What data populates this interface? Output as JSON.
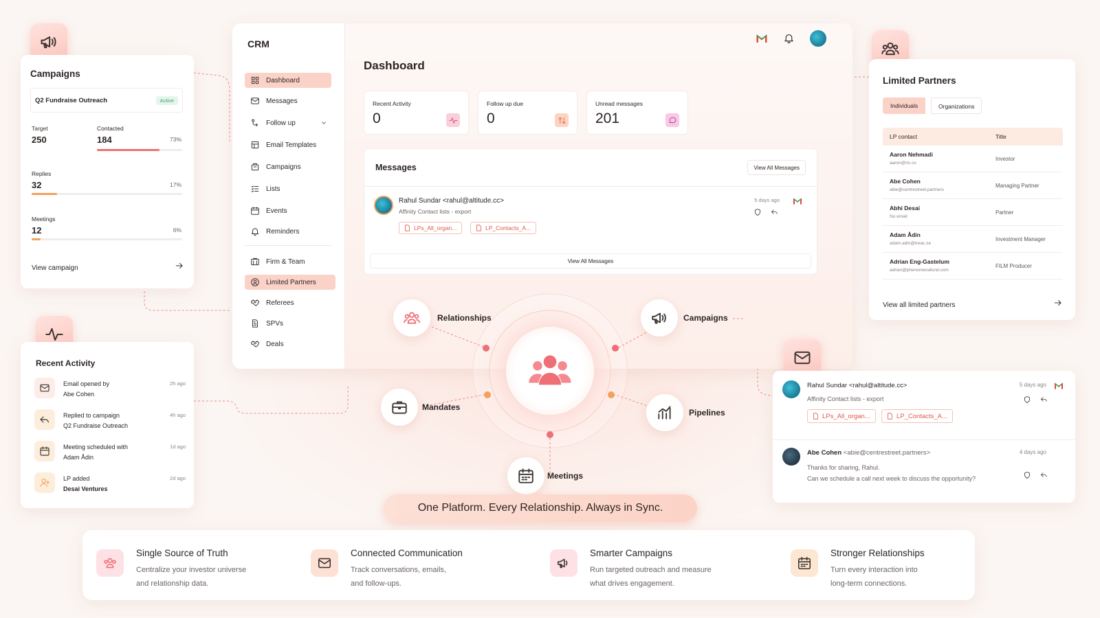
{
  "campaigns": {
    "title": "Campaigns",
    "campaign_name": "Q2 Fundraise Outreach",
    "status": "Active",
    "target_label": "Target",
    "target_value": "250",
    "contacted_label": "Contacted",
    "contacted_value": "184",
    "contacted_pct": "73%",
    "contacted_fraction": 0.73,
    "replies_label": "Replies",
    "replies_value": "32",
    "replies_pct": "17%",
    "replies_fraction": 0.17,
    "meetings_label": "Meetings",
    "meetings_value": "12",
    "meetings_pct": "6%",
    "meetings_fraction": 0.06,
    "view_link": "View campaign"
  },
  "recent_activity": {
    "title": "Recent Activity",
    "items": [
      {
        "line1": "Email opened by",
        "line2": "Abe Cohen",
        "ago": "2h ago",
        "icon": "mail-icon"
      },
      {
        "line1": "Replied to campaign",
        "line2": "Q2 Fundraise Outreach",
        "ago": "4h ago",
        "icon": "reply-icon"
      },
      {
        "line1": "Meeting scheduled with",
        "line2": "Adam Ådin",
        "ago": "1d ago",
        "icon": "calendar-icon"
      },
      {
        "line1": "LP added",
        "line2": "Desai Ventures",
        "ago": "2d ago",
        "icon": "user-add-icon"
      }
    ]
  },
  "crm": {
    "app_title": "CRM",
    "nav": [
      {
        "label": "Dashboard",
        "icon": "grid-icon",
        "active": true
      },
      {
        "label": "Messages",
        "icon": "mail-icon"
      },
      {
        "label": "Follow up",
        "icon": "follow-up-icon",
        "expandable": true
      },
      {
        "label": "Email Templates",
        "icon": "template-icon"
      },
      {
        "label": "Campaigns",
        "icon": "campaign-icon"
      },
      {
        "label": "Lists",
        "icon": "list-icon"
      },
      {
        "label": "Events",
        "icon": "calendar-icon"
      },
      {
        "label": "Reminders",
        "icon": "bell-icon"
      },
      {
        "label": "Firm & Team",
        "icon": "building-icon"
      },
      {
        "label": "Limited Partners",
        "icon": "user-circle-icon",
        "active": true
      },
      {
        "label": "Referees",
        "icon": "handshake-icon"
      },
      {
        "label": "SPVs",
        "icon": "document-icon"
      },
      {
        "label": "Deals",
        "icon": "handshake-icon"
      }
    ],
    "page_title": "Dashboard",
    "stats": [
      {
        "label": "Recent Activity",
        "value": "0",
        "icon": "activity-icon",
        "color": "#f8d0dc"
      },
      {
        "label": "Follow up due",
        "value": "0",
        "icon": "swap-icon",
        "color": "#fcd4c2"
      },
      {
        "label": "Unread messages",
        "value": "201",
        "icon": "chat-icon",
        "color": "#f7c9e4"
      }
    ],
    "messages": {
      "title": "Messages",
      "view_all_button": "View All Messages",
      "sender": "Rahul Sundar <rahul@altitude.cc>",
      "subject": "Affinity Contact lists - export",
      "ago": "5 days ago",
      "attachments": [
        "LPs_All_organ...",
        "LP_Contacts_A..."
      ],
      "view_all_footer": "View All Messages"
    }
  },
  "limited_partners": {
    "title": "Limited Partners",
    "tabs": [
      "Individuals",
      "Organizations"
    ],
    "columns": [
      "LP contact",
      "Title"
    ],
    "rows": [
      {
        "name": "Aaron Nehmadi",
        "email": "aaron@ric.co",
        "title": "Investor"
      },
      {
        "name": "Abe Cohen",
        "email": "abie@centrestreet.partners",
        "title": "Managing Partner"
      },
      {
        "name": "Abhi Desai",
        "email": "No email",
        "title": "Partner"
      },
      {
        "name": "Adam Ådin",
        "email": "adam.adin@treac.se",
        "title": "Investment Manager"
      },
      {
        "name": "Adrian Eng-Gastelum",
        "email": "adrian@phenomenafund.com",
        "title": "FILM Producer"
      }
    ],
    "view_all": "View all limited partners"
  },
  "inbox": {
    "messages": [
      {
        "sender": "Rahul Sundar <rahul@altitude.cc>",
        "subject": "Affinity Contact lists - export",
        "ago": "5 days ago",
        "attachments": [
          "LPs_All_organ...",
          "LP_Contacts_A..."
        ]
      },
      {
        "sender_name": "Abe Cohen",
        "sender_email": "<abie@centrestreet.partners>",
        "line1": "Thanks for sharing, Rahul.",
        "line2": "Can we schedule a call next week to discuss the opportunity?",
        "ago": "4 days ago"
      }
    ]
  },
  "hub": {
    "nodes": [
      {
        "label": "Relationships",
        "icon": "users-icon"
      },
      {
        "label": "Campaigns",
        "icon": "megaphone-icon"
      },
      {
        "label": "Mandates",
        "icon": "briefcase-icon"
      },
      {
        "label": "Pipelines",
        "icon": "chart-icon"
      },
      {
        "label": "Meetings",
        "icon": "calendar-icon"
      }
    ],
    "tagline": "One Platform. Every Relationship. Always in Sync."
  },
  "features": [
    {
      "title": "Single Source of Truth",
      "line1": "Centralize your investor universe",
      "line2": "and relationship data.",
      "icon": "users-icon",
      "color": "#fde1e5"
    },
    {
      "title": "Connected Communication",
      "line1": "Track conversations, emails,",
      "line2": "and follow-ups.",
      "icon": "mail-icon",
      "color": "#fde1d5"
    },
    {
      "title": "Smarter Campaigns",
      "line1": "Run targeted outreach and measure",
      "line2": "what drives engagement.",
      "icon": "megaphone-icon",
      "color": "#fde1e5"
    },
    {
      "title": "Stronger Relationships",
      "line1": "Turn every interaction into",
      "line2": "long-term connections.",
      "icon": "calendar-icon",
      "color": "#fde6d2"
    }
  ],
  "colors": {
    "accent": "#ef6f76",
    "accent_orange": "#f3a15b",
    "active_nav": "#fbd2c7",
    "status_green": "#3aa66a"
  }
}
